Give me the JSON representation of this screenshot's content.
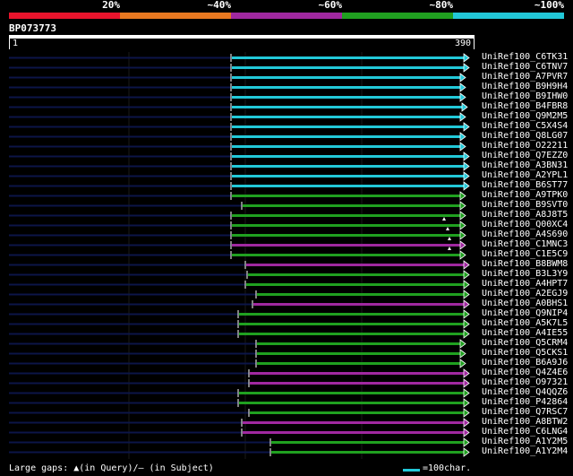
{
  "legend": {
    "segments": [
      {
        "label": "20%",
        "color": "#e8142c"
      },
      {
        "label": "~40%",
        "color": "#e87820"
      },
      {
        "label": "~60%",
        "color": "#a028a0"
      },
      {
        "label": "~80%",
        "color": "#20a020"
      },
      {
        "label": "~100%",
        "color": "#22c8d8"
      }
    ]
  },
  "query": {
    "label": "BP073773",
    "start": "1",
    "end": "390"
  },
  "colors": {
    "cyan": "#22c8d8",
    "green": "#20a020",
    "purple": "#a028a0",
    "navy": "#0c1548",
    "white": "#ffffff"
  },
  "hits": [
    {
      "name": "UniRef100_C6TK31",
      "start": "UniRef100_C6TK31",
      "color": "cyan"
    },
    {
      "name": "UniRef100_C6TNV7",
      "color": "cyan"
    },
    {
      "name": "UniRef100_A7PVR7",
      "color": "cyan"
    },
    {
      "name": "UniRef100_B9H9H4",
      "color": "cyan"
    },
    {
      "name": "UniRef100_B9IHW0",
      "color": "cyan"
    },
    {
      "name": "UniRef100_B4FBR8",
      "color": "cyan"
    },
    {
      "name": "UniRef100_Q9M2M5",
      "color": "cyan"
    },
    {
      "name": "UniRef100_C5X4S4",
      "color": "cyan"
    },
    {
      "name": "UniRef100_Q8LG07",
      "color": "cyan"
    },
    {
      "name": "UniRef100_O22211",
      "color": "cyan"
    },
    {
      "name": "UniRef100_Q7EZZ0",
      "color": "cyan"
    },
    {
      "name": "UniRef100_A3BN31",
      "color": "cyan"
    },
    {
      "name": "UniRef100_A2YPL1",
      "color": "cyan"
    },
    {
      "name": "UniRef100_B6ST77",
      "color": "cyan"
    },
    {
      "name": "UniRef100_A9TPK0",
      "color": "green"
    },
    {
      "name": "UniRef100_B9SVT0",
      "color": "green"
    },
    {
      "name": "UniRef100_A8J8T5",
      "color": "green"
    },
    {
      "name": "UniRef100_Q00XC4",
      "color": "green"
    },
    {
      "name": "UniRef100_A4S690",
      "color": "green"
    },
    {
      "name": "UniRef100_C1MNC3",
      "color": "purple"
    },
    {
      "name": "UniRef100_C1E5C9",
      "color": "green"
    },
    {
      "name": "UniRef100_B8BWM8",
      "color": "purple"
    },
    {
      "name": "UniRef100_B3L3Y9",
      "color": "green"
    },
    {
      "name": "UniRef100_A4HPT7",
      "color": "green"
    },
    {
      "name": "UniRef100_A2EGJ9",
      "color": "green"
    },
    {
      "name": "UniRef100_A0BHS1",
      "color": "purple"
    },
    {
      "name": "UniRef100_Q9NIP4",
      "color": "green"
    },
    {
      "name": "UniRef100_A5K7L5",
      "color": "green"
    },
    {
      "name": "UniRef100_A4IE55",
      "color": "green"
    },
    {
      "name": "UniRef100_Q5CRM4",
      "color": "green"
    },
    {
      "name": "UniRef100_Q5CKS1",
      "color": "green"
    },
    {
      "name": "UniRef100_B6A9J6",
      "color": "green"
    },
    {
      "name": "UniRef100_Q4Z4E6",
      "color": "purple"
    },
    {
      "name": "UniRef100_O97321",
      "color": "purple"
    },
    {
      "name": "UniRef100_Q4QQZ6",
      "color": "green"
    },
    {
      "name": "UniRef100_P42864",
      "color": "green"
    },
    {
      "name": "UniRef100_Q7RSC7",
      "color": "green"
    },
    {
      "name": "UniRef100_A8BTW2",
      "color": "purple"
    },
    {
      "name": "UniRef100_C6LNG4",
      "color": "purple"
    },
    {
      "name": "UniRef100_A1Y2M5",
      "color": "green"
    },
    {
      "name": "UniRef100_A1Y2M4",
      "color": "green"
    }
  ],
  "footer": {
    "gaps": "Large gaps: ▲(in Query)/– (in Subject)",
    "scale": "=100char."
  }
}
